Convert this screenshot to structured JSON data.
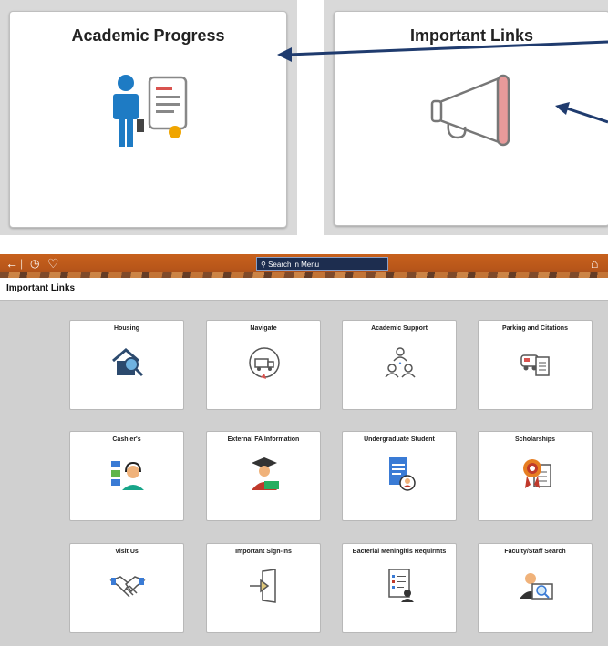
{
  "top_tiles": [
    {
      "title": "Academic Progress",
      "icon": "student-certificate-icon"
    },
    {
      "title": "Important Links",
      "icon": "megaphone-icon"
    }
  ],
  "banner": {
    "back_icon": "arrow-left-icon",
    "recent_icon": "clock-icon",
    "favorites_icon": "heart-icon",
    "search_placeholder": "Search in Menu",
    "home_icon": "home-icon",
    "color": "#c8611c"
  },
  "page": {
    "title": "Important Links"
  },
  "tiles": [
    {
      "label": "Housing",
      "icon": "house-search-icon"
    },
    {
      "label": "Navigate",
      "icon": "truck-route-icon"
    },
    {
      "label": "Academic Support",
      "icon": "people-network-icon"
    },
    {
      "label": "Parking and Citations",
      "icon": "car-ticket-icon"
    },
    {
      "label": "Cashier's",
      "icon": "cashier-headset-icon"
    },
    {
      "label": "External FA Information",
      "icon": "graduate-money-icon"
    },
    {
      "label": "Undergraduate Student",
      "icon": "student-document-icon"
    },
    {
      "label": "Scholarships",
      "icon": "award-ribbon-icon"
    },
    {
      "label": "Visit Us",
      "icon": "handshake-icon"
    },
    {
      "label": "Important Sign-Ins",
      "icon": "sign-in-door-icon"
    },
    {
      "label": "Bacterial Meningitis Requirmts",
      "icon": "checklist-person-icon"
    },
    {
      "label": "Faculty/Staff Search",
      "icon": "person-magnifier-icon"
    }
  ]
}
